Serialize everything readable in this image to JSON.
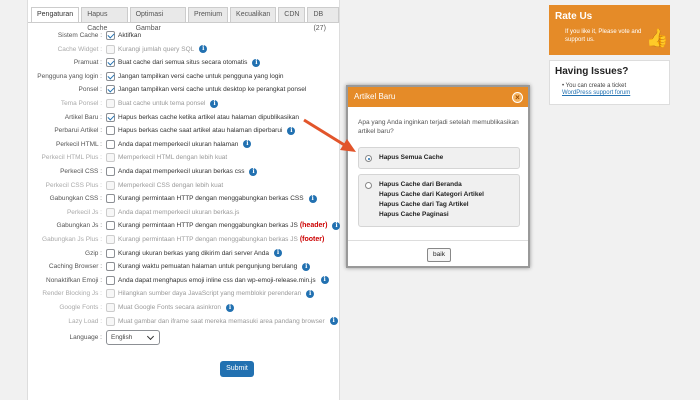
{
  "tabs": [
    "Pengaturan",
    "Hapus Cache",
    "Optimasi Gambar",
    "Premium",
    "Kecualikan",
    "CDN",
    "DB (27)"
  ],
  "settings": [
    {
      "label": "Sistem Cache :",
      "text": "Aktifkan",
      "checked": true,
      "enabled": true,
      "info": false
    },
    {
      "label": "Cache Widget :",
      "text": "Kurangi jumlah query SQL",
      "checked": false,
      "enabled": false,
      "info": true
    },
    {
      "label": "Pramuat :",
      "text": "Buat cache dari semua situs secara otomatis",
      "checked": true,
      "enabled": true,
      "info": true
    },
    {
      "label": "Pengguna yang login :",
      "text": "Jangan tampilkan versi cache untuk pengguna yang login",
      "checked": true,
      "enabled": true,
      "info": false
    },
    {
      "label": "Ponsel :",
      "text": "Jangan tampilkan versi cache untuk desktop ke perangkat ponsel",
      "checked": true,
      "enabled": true,
      "info": false
    },
    {
      "label": "Tema Ponsel :",
      "text": "Buat cache untuk tema ponsel",
      "checked": false,
      "enabled": false,
      "info": true
    },
    {
      "label": "Artikel Baru :",
      "text": "Hapus berkas cache ketika artikel atau halaman dipublikasikan",
      "checked": true,
      "enabled": true,
      "info": false
    },
    {
      "label": "Perbarui Artikel :",
      "text": "Hapus berkas cache saat artikel atau halaman diperbarui",
      "checked": false,
      "enabled": true,
      "info": true
    },
    {
      "label": "Perkecil HTML :",
      "text": "Anda dapat memperkecil ukuran halaman",
      "checked": false,
      "enabled": true,
      "info": true
    },
    {
      "label": "Perkecil HTML Plus :",
      "text": "Memperkecil HTML dengan lebih kuat",
      "checked": false,
      "enabled": false,
      "info": false
    },
    {
      "label": "Perkecil CSS :",
      "text": "Anda dapat memperkecil ukuran berkas css",
      "checked": false,
      "enabled": true,
      "info": true
    },
    {
      "label": "Perkecil CSS Plus :",
      "text": "Memperkecil CSS dengan lebih kuat",
      "checked": false,
      "enabled": false,
      "info": false
    },
    {
      "label": "Gabungkan CSS :",
      "text": "Kurangi permintaan HTTP dengan menggabungkan berkas CSS",
      "checked": false,
      "enabled": true,
      "info": true
    },
    {
      "label": "Perkecil Js :",
      "text": "Anda dapat memperkecil ukuran berkas.js",
      "checked": false,
      "enabled": false,
      "info": false
    },
    {
      "label": "Gabungkan Js :",
      "text": "Kurangi permintaan HTTP dengan menggabungkan berkas JS",
      "suffix": "(header)",
      "checked": false,
      "enabled": true,
      "info": true
    },
    {
      "label": "Gabungkan Js Plus :",
      "text": "Kurangi permintaan HTTP dengan menggabungkan berkas JS",
      "suffix": "(footer)",
      "checked": false,
      "enabled": false,
      "info": false
    },
    {
      "label": "Gzip :",
      "text": "Kurangi ukuran berkas yang dikirim dari server Anda",
      "checked": false,
      "enabled": true,
      "info": true
    },
    {
      "label": "Caching Browser :",
      "text": "Kurangi waktu pemuatan halaman untuk pengunjung berulang",
      "checked": false,
      "enabled": true,
      "info": true
    },
    {
      "label": "Nonaktifkan Emoji :",
      "text": "Anda dapat menghapus emoji inline css dan wp-emoji-release.min.js",
      "checked": false,
      "enabled": true,
      "info": true
    },
    {
      "label": "Render Blocking Js :",
      "text": "Hilangkan sumber daya JavaScript yang memblokir perenderan",
      "checked": false,
      "enabled": false,
      "info": true
    },
    {
      "label": "Google Fonts :",
      "text": "Muat Google Fonts secara asinkron",
      "checked": false,
      "enabled": false,
      "info": true
    },
    {
      "label": "Lazy Load :",
      "text": "Muat gambar dan iframe saat mereka memasuki area pandang browser",
      "checked": false,
      "enabled": false,
      "info": true
    }
  ],
  "language": {
    "label": "Language :",
    "value": "English"
  },
  "submit_label": "Submit",
  "rate": {
    "title": "Rate Us",
    "text": "If you like it, Please vote and support us."
  },
  "issues": {
    "title": "Having Issues?",
    "text": "You can create a ticket",
    "link": "WordPress support forum"
  },
  "modal": {
    "title": "Artikel Baru",
    "close": "×",
    "question": "Apa yang Anda inginkan terjadi setelah memublikasikan artikel baru?",
    "option1": "Hapus Semua Cache",
    "option2_lines": [
      "Hapus Cache dari Beranda",
      "Hapus Cache dari Kategori Artikel",
      "Hapus Cache dari Tag Artikel",
      "Hapus Cache Paginasi"
    ],
    "ok_label": "baik"
  },
  "colors": {
    "accent": "#e58b28",
    "primary": "#2271b1",
    "arrow": "#e2552b"
  }
}
